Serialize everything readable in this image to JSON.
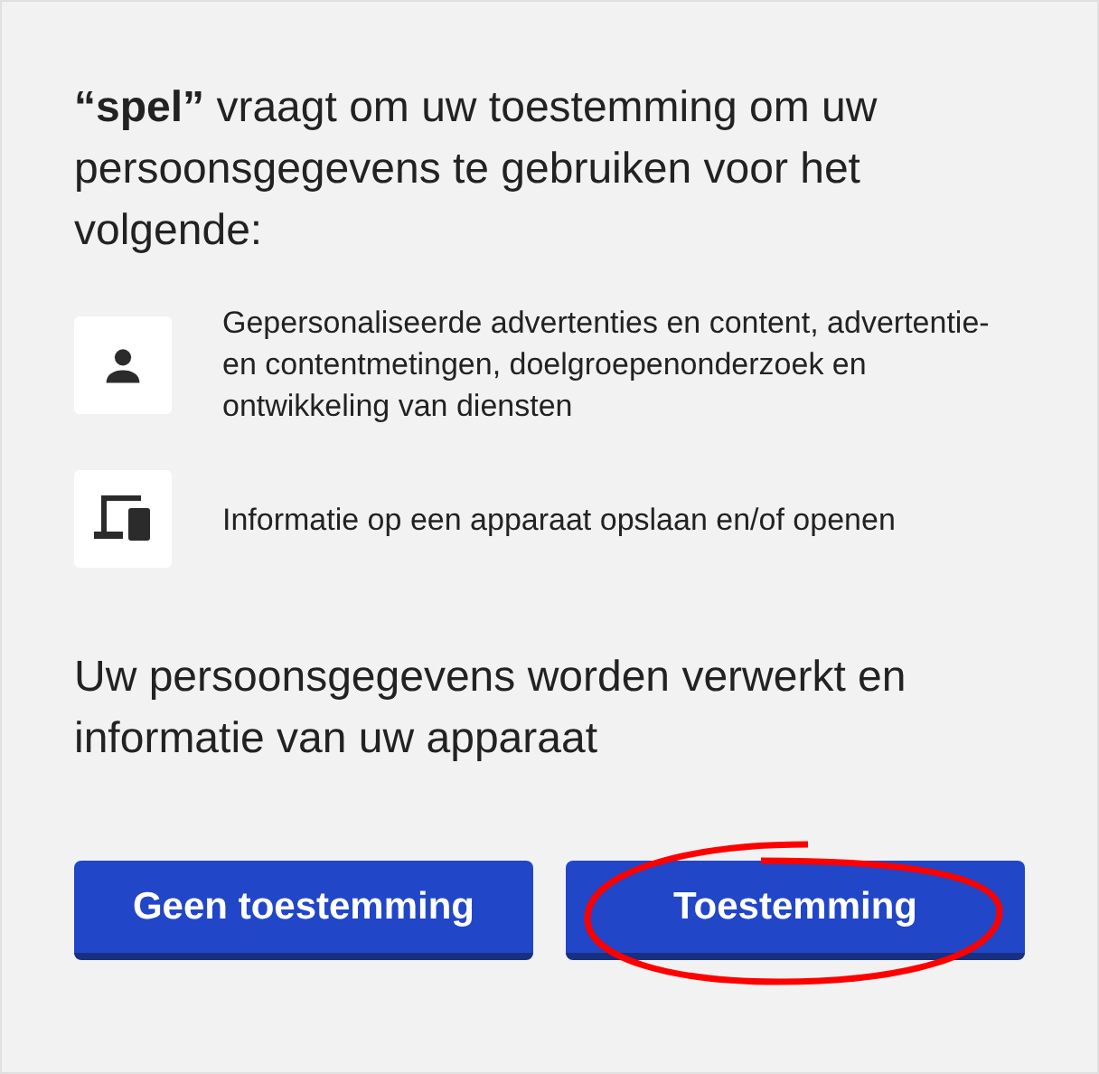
{
  "heading": "**“spel”** vraagt om uw toestemming om uw persoonsgegevens te gebruiken voor het volgende:",
  "purposes": [
    {
      "kind": "person",
      "text": "Gepersonaliseerde advertenties en content, advertentie-en contentmetingen, doelgroepenonderzoek en ontwikkeling van diensten"
    },
    {
      "kind": "device",
      "text": "Informatie op een apparaat opslaan en/of openen"
    }
  ],
  "notice": "Uw persoonsgegevens worden verwerkt en informatie van uw apparaat",
  "buttons": [
    {
      "label": "Geen toestemming",
      "circled": false
    },
    {
      "label": "Toestemming",
      "circled": true
    }
  ]
}
